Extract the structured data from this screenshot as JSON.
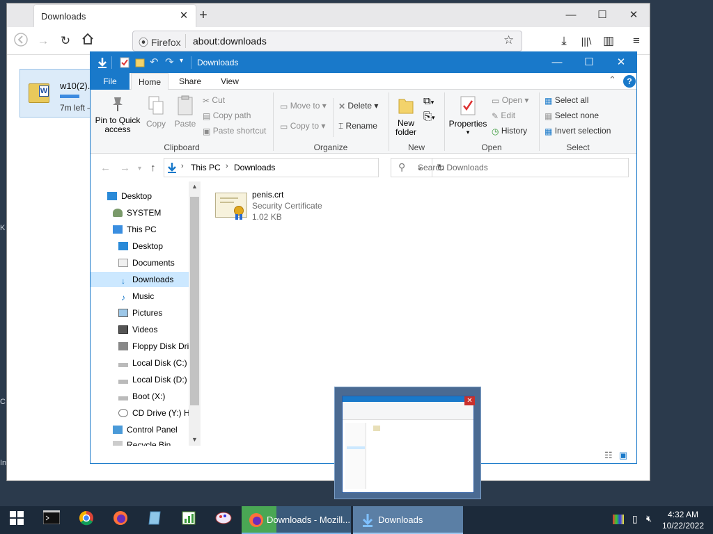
{
  "firefox": {
    "tab_title": "Downloads",
    "identity_label": "Firefox",
    "url": "about:downloads",
    "download": {
      "filename": "w10(2).v",
      "status": "7m left –",
      "progress": 0.6
    }
  },
  "explorer": {
    "title": "Downloads",
    "tabs": {
      "file": "File",
      "home": "Home",
      "share": "Share",
      "view": "View"
    },
    "ribbon": {
      "clipboard": {
        "label": "Clipboard",
        "pin": "Pin to Quick access",
        "copy": "Copy",
        "paste": "Paste",
        "cut": "Cut",
        "copy_path": "Copy path",
        "paste_shortcut": "Paste shortcut"
      },
      "organize": {
        "label": "Organize",
        "move_to": "Move to",
        "copy_to": "Copy to",
        "delete": "Delete",
        "rename": "Rename"
      },
      "new": {
        "label": "New",
        "new_folder": "New folder"
      },
      "open": {
        "label": "Open",
        "properties": "Properties",
        "open": "Open",
        "edit": "Edit",
        "history": "History"
      },
      "select": {
        "label": "Select",
        "select_all": "Select all",
        "select_none": "Select none",
        "invert": "Invert selection"
      }
    },
    "address": {
      "this_pc": "This PC",
      "downloads": "Downloads"
    },
    "search_placeholder": "Search Downloads",
    "nav": [
      "Desktop",
      "SYSTEM",
      "This PC",
      "Desktop",
      "Documents",
      "Downloads",
      "Music",
      "Pictures",
      "Videos",
      "Floppy Disk Dri",
      "Local Disk (C:)",
      "Local Disk (D:)",
      "Boot (X:)",
      "CD Drive (Y:) H",
      "Control Panel",
      "Recycle Bin"
    ],
    "file": {
      "name": "penis.crt",
      "type": "Security Certificate",
      "size": "1.02 KB"
    }
  },
  "taskbar": {
    "firefox_task": "Downloads - Mozill...",
    "explorer_task": "Downloads",
    "time": "4:32 AM",
    "date": "10/22/2022"
  },
  "colors": {
    "explorer_blue": "#1979ca",
    "taskbar": "#1c2a3a",
    "selection": "#cce8ff"
  }
}
